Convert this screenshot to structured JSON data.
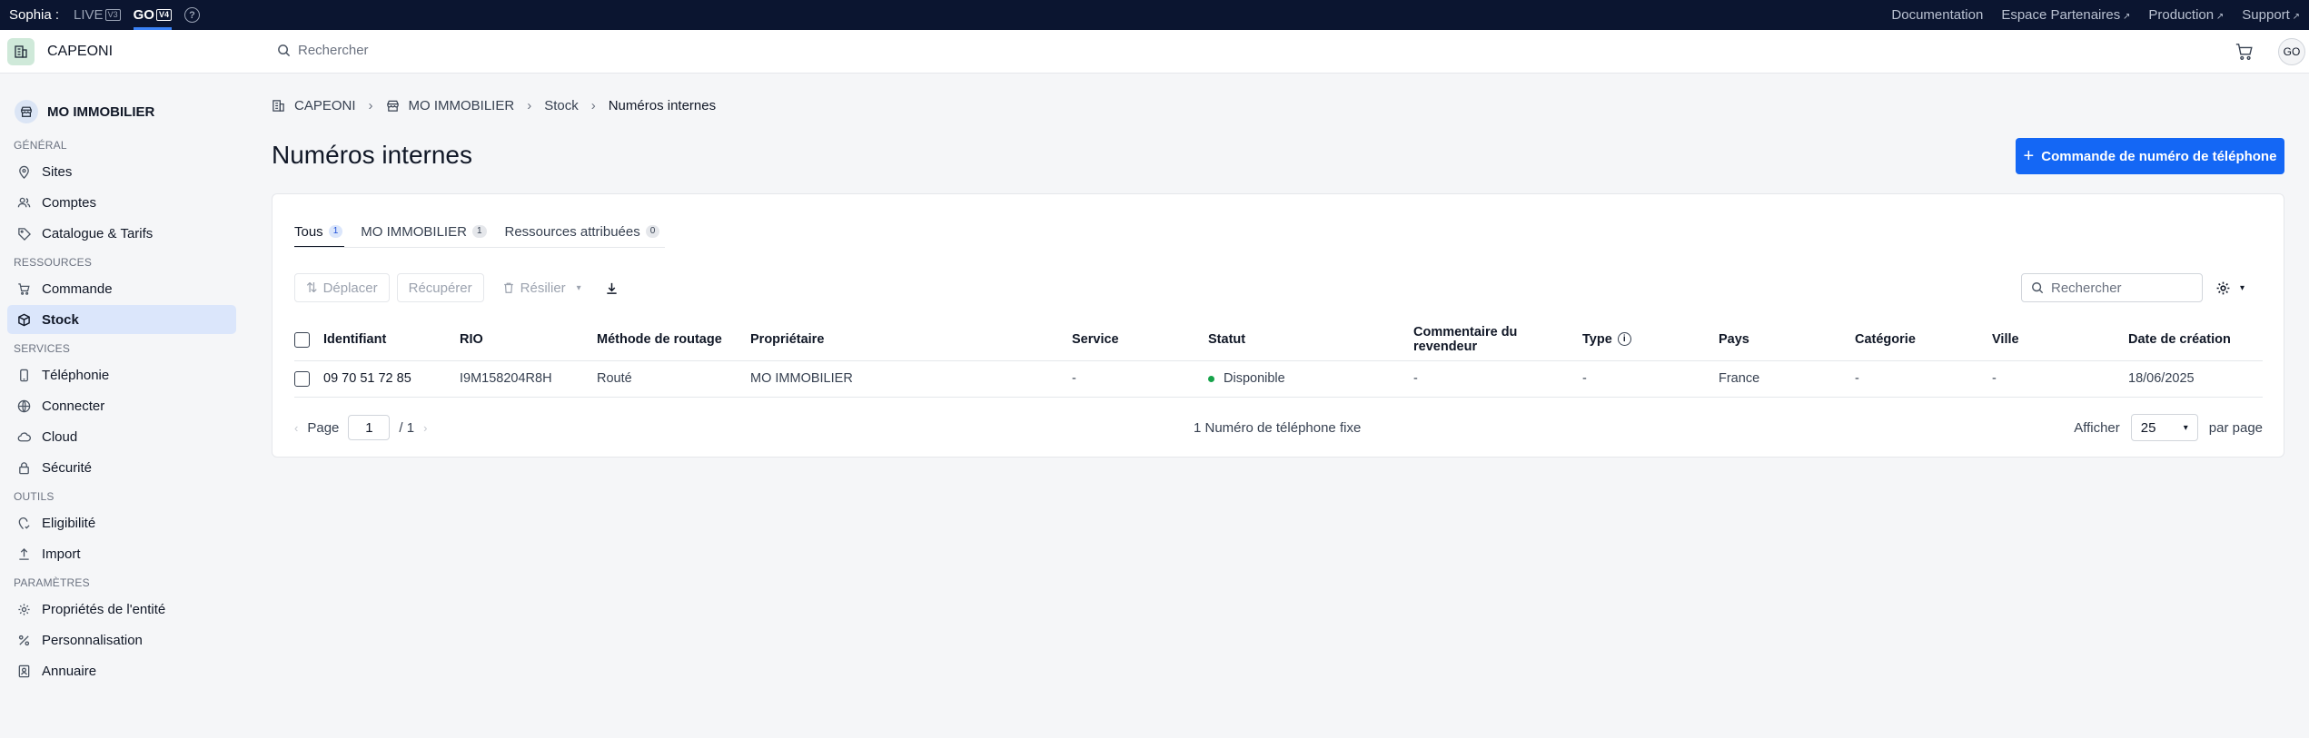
{
  "topbar": {
    "brand": "Sophia :",
    "envs": [
      {
        "label": "LIVE",
        "tag": "V3"
      },
      {
        "label": "GO",
        "tag": "V4"
      }
    ],
    "help": "?",
    "links": [
      "Documentation",
      "Espace Partenaires",
      "Production",
      "Support"
    ]
  },
  "header": {
    "app_name": "CAPEONI",
    "search_placeholder": "Rechercher",
    "avatar": "GO"
  },
  "sidebar": {
    "org": "MO IMMOBILIER",
    "sections": [
      {
        "title": "GÉNÉRAL",
        "items": [
          "Sites",
          "Comptes",
          "Catalogue & Tarifs"
        ]
      },
      {
        "title": "RESSOURCES",
        "items": [
          "Commande",
          "Stock"
        ]
      },
      {
        "title": "SERVICES",
        "items": [
          "Téléphonie",
          "Connecter",
          "Cloud",
          "Sécurité"
        ]
      },
      {
        "title": "OUTILS",
        "items": [
          "Eligibilité",
          "Import"
        ]
      },
      {
        "title": "PARAMÈTRES",
        "items": [
          "Propriétés de l'entité",
          "Personnalisation",
          "Annuaire"
        ]
      }
    ]
  },
  "breadcrumb": [
    "CAPEONI",
    "MO IMMOBILIER",
    "Stock",
    "Numéros internes"
  ],
  "page": {
    "title": "Numéros internes",
    "primary_action": "Commande de numéro de téléphone"
  },
  "tabs": [
    {
      "label": "Tous",
      "count": "1"
    },
    {
      "label": "MO IMMOBILIER",
      "count": "1"
    },
    {
      "label": "Ressources attribuées",
      "count": "0"
    }
  ],
  "toolbar": {
    "move": "Déplacer",
    "recover": "Récupérer",
    "terminate": "Résilier",
    "search_placeholder": "Rechercher"
  },
  "table": {
    "columns": [
      "Identifiant",
      "RIO",
      "Méthode de routage",
      "Propriétaire",
      "Service",
      "Statut",
      "Commentaire du revendeur",
      "Type",
      "Pays",
      "Catégorie",
      "Ville",
      "Date de création"
    ],
    "rows": [
      [
        "09 70 51 72 85",
        "I9M158204R8H",
        "Routé",
        "MO IMMOBILIER",
        "-",
        "Disponible",
        "-",
        "-",
        "France",
        "-",
        "-",
        "18/06/2025"
      ]
    ]
  },
  "footer": {
    "page_label": "Page",
    "page_value": "1",
    "page_total": "/ 1",
    "count_text": "1 Numéro de téléphone fixe",
    "show_label": "Afficher",
    "per_page_value": "25",
    "per_page_suffix": "par page"
  },
  "colors": {
    "topbar": "#0b1530",
    "primary": "#1467f5",
    "active_nav": "#dbe6fb",
    "status_ok": "#16a34a"
  }
}
